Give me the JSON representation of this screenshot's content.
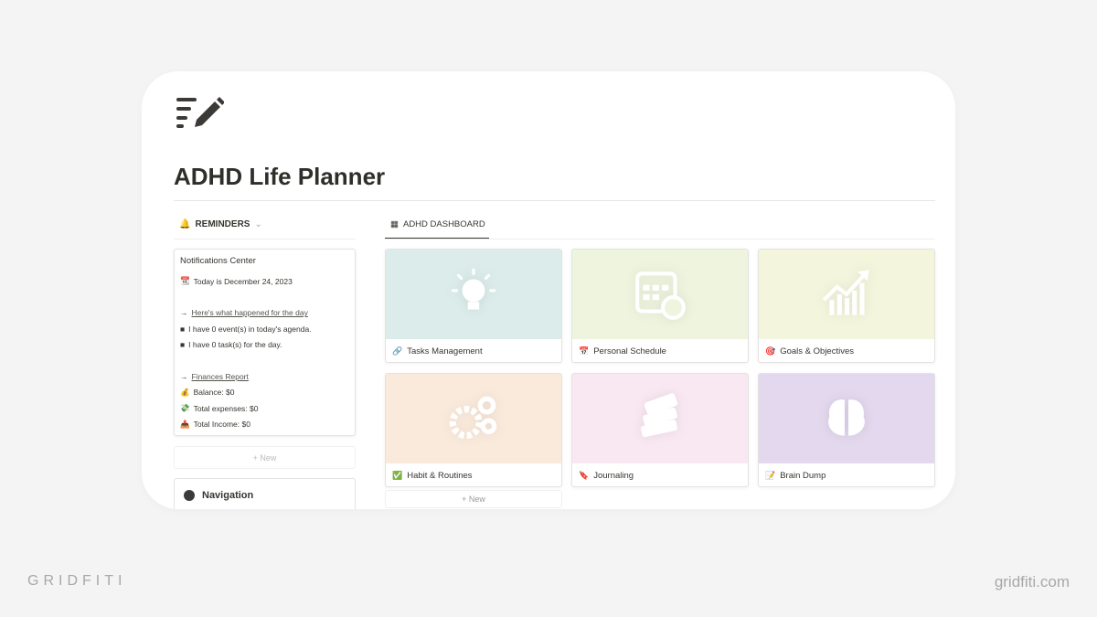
{
  "page": {
    "title": "ADHD Life Planner",
    "icon": "notes-pencil-icon"
  },
  "reminders": {
    "header": "REMINDERS",
    "notifications": {
      "title": "Notifications Center",
      "today": "Today is December 24, 2023",
      "day_link": "Here's what happened for the day",
      "events": "I have 0 event(s) in today's agenda.",
      "tasks": "I have 0 task(s) for the day.",
      "finance_link": "Finances Report",
      "balance": "Balance: $0",
      "expenses": "Total expenses: $0",
      "income": "Total Income: $0"
    },
    "new_label": "New"
  },
  "navigation": {
    "title": "Navigation"
  },
  "dashboard": {
    "tab": "ADHD DASHBOARD",
    "new_label": "New",
    "cards": [
      {
        "label": "Tasks Management",
        "bg": "#dcecea",
        "icon": "lightbulb-icon"
      },
      {
        "label": "Personal Schedule",
        "bg": "#eef4de",
        "icon": "calendar-clock-icon"
      },
      {
        "label": "Goals & Objectives",
        "bg": "#f3f5dc",
        "icon": "growth-chart-icon"
      },
      {
        "label": "Habit & Routines",
        "bg": "#faeadc",
        "icon": "gears-icon"
      },
      {
        "label": "Journaling",
        "bg": "#f9e8f1",
        "icon": "books-icon"
      },
      {
        "label": "Brain Dump",
        "bg": "#e3d8ee",
        "icon": "brain-icon"
      }
    ]
  },
  "watermark": {
    "left": "GRIDFITI",
    "right": "gridfiti.com"
  }
}
